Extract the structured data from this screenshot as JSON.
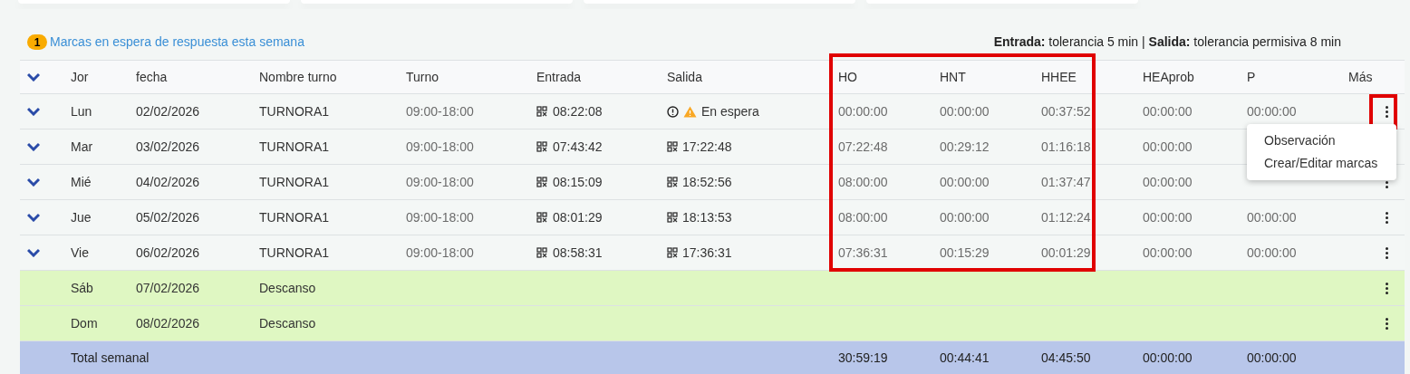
{
  "notice": {
    "count": "1",
    "link": "Marcas en espera de respuesta esta semana"
  },
  "tolerance": "**Entrada:** tolerancia 5 min | **Salida:** tolerancia permisiva 8 min",
  "columns": {
    "before_frame": [
      "Jor",
      "fecha",
      "Nombre turno",
      "Turno",
      "Entrada",
      "Salida"
    ],
    "framed": [
      "HO",
      "HNT",
      "HHEE"
    ],
    "after_frame": [
      "HEAprob",
      "P",
      "Más"
    ]
  },
  "rows": [
    {
      "kind": "work",
      "day": "Lun",
      "date": "02/02/2026",
      "shift_name": "TURNORA1",
      "shift": "09:00-18:00",
      "in": "08:22:08",
      "out": {
        "kind": "pending",
        "text": "En espera"
      },
      "ho": "00:00:00",
      "hnt": "00:00:00",
      "hhee": "00:37:52",
      "heaprob": "00:00:00",
      "p": "00:00:00",
      "more": true,
      "more_highlighted": true
    },
    {
      "kind": "work",
      "day": "Mar",
      "date": "03/02/2026",
      "shift_name": "TURNORA1",
      "shift": "09:00-18:00",
      "in": "07:43:42",
      "out": {
        "kind": "qr",
        "text": "17:22:48"
      },
      "ho": "07:22:48",
      "hnt": "00:29:12",
      "hhee": "01:16:18",
      "heaprob": "00:00:00"
    },
    {
      "kind": "work",
      "day": "Mié",
      "date": "04/02/2026",
      "shift_name": "TURNORA1",
      "shift": "09:00-18:00",
      "in": "08:15:09",
      "out": {
        "kind": "qr",
        "text": "18:52:56"
      },
      "ho": "08:00:00",
      "hnt": "00:00:00",
      "hhee": "01:37:47",
      "heaprob": "00:00:00",
      "more": true,
      "more_highlighted": false
    },
    {
      "kind": "work",
      "day": "Jue",
      "date": "05/02/2026",
      "shift_name": "TURNORA1",
      "shift": "09:00-18:00",
      "in": "08:01:29",
      "out": {
        "kind": "qr",
        "text": "18:13:53"
      },
      "ho": "08:00:00",
      "hnt": "00:00:00",
      "hhee": "01:12:24",
      "heaprob": "00:00:00",
      "p": "00:00:00",
      "more": true,
      "more_highlighted": false
    },
    {
      "kind": "work",
      "day": "Vie",
      "date": "06/02/2026",
      "shift_name": "TURNORA1",
      "shift": "09:00-18:00",
      "in": "08:58:31",
      "out": {
        "kind": "qr",
        "text": "17:36:31"
      },
      "ho": "07:36:31",
      "hnt": "00:15:29",
      "hhee": "00:01:29",
      "heaprob": "00:00:00",
      "p": "00:00:00",
      "more": true,
      "more_highlighted": false
    },
    {
      "kind": "rest",
      "day": "Sáb",
      "date": "07/02/2026",
      "shift_name": "Descanso",
      "more": true,
      "more_highlighted": false
    },
    {
      "kind": "rest",
      "day": "Dom",
      "date": "08/02/2026",
      "shift_name": "Descanso",
      "more": true,
      "more_highlighted": false
    },
    {
      "kind": "total",
      "label": "Total semanal",
      "ho": "30:59:19",
      "hnt": "00:44:41",
      "hhee": "04:45:50",
      "heaprob": "00:00:00",
      "p": "00:00:00"
    }
  ],
  "menu": {
    "items": [
      "Observación",
      "Crear/Editar marcas"
    ]
  }
}
